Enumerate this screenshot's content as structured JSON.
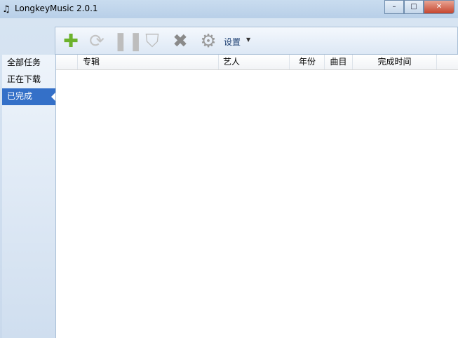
{
  "window": {
    "title": "LongkeyMusic 2.0.1"
  },
  "toolbar": {
    "settings_label": "设置"
  },
  "sidebar": {
    "items": [
      {
        "label": "全部任务"
      },
      {
        "label": "正在下载"
      },
      {
        "label": "已完成"
      }
    ],
    "selected": 2
  },
  "table": {
    "columns": [
      "专辑",
      "艺人",
      "年份",
      "曲目",
      "完成时间"
    ],
    "rows": []
  }
}
